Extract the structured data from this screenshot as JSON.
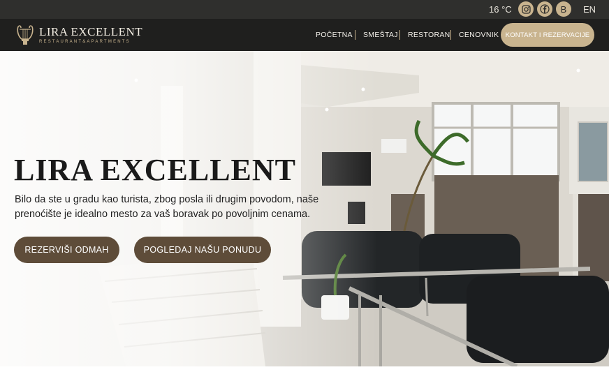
{
  "topbar": {
    "temperature": "16 °C",
    "social": [
      {
        "icon": "instagram-icon"
      },
      {
        "icon": "facebook-icon"
      },
      {
        "icon": "booking-icon",
        "glyph": "B"
      }
    ],
    "language": "EN"
  },
  "brand": {
    "name": "LIRA EXCELLENT",
    "tagline": "RESTAURANT&APARTMENTS",
    "logo_icon": "lyre-icon"
  },
  "nav": {
    "items": [
      {
        "label": "POČETNA"
      },
      {
        "label": "SMEŠTAJ"
      },
      {
        "label": "RESTORAN"
      },
      {
        "label": "CENOVNIK"
      }
    ],
    "cta_label": "KONTAKT I REZERVACIJE"
  },
  "hero": {
    "title": "LIRA EXCELLENT",
    "text": "Bilo da ste u gradu kao turista, zbog posla ili drugim povodom, naše prenoćište je idealno mesto za vaš boravak po povoljnim cenama.",
    "buttons": {
      "reserve": "REZERVIŠI ODMAH",
      "offer": "POGLEDAJ NAŠU PONUDU"
    }
  },
  "colors": {
    "accent_gold": "#c9b48f",
    "button_brown": "#5e4c39",
    "nav_dark": "#1f1f1e",
    "topbar_dark": "#2f2f2d"
  }
}
